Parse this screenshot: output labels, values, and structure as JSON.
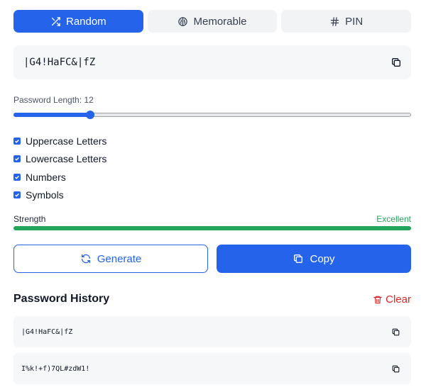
{
  "tabs": [
    {
      "label": "Random",
      "icon": "shuffle-icon",
      "active": true
    },
    {
      "label": "Memorable",
      "icon": "brain-icon",
      "active": false
    },
    {
      "label": "PIN",
      "icon": "hash-icon",
      "active": false
    }
  ],
  "password": {
    "value": "|G4!HaFC&|fZ",
    "copy_icon": "copy-icon"
  },
  "length": {
    "label": "Password Length: 12",
    "value": 12,
    "min": 4,
    "max": 64
  },
  "options": [
    {
      "label": "Uppercase Letters",
      "checked": true
    },
    {
      "label": "Lowercase Letters",
      "checked": true
    },
    {
      "label": "Numbers",
      "checked": true
    },
    {
      "label": "Symbols",
      "checked": true
    }
  ],
  "strength": {
    "label": "Strength",
    "value": "Excellent",
    "level": 1.0,
    "color": "#22a55a"
  },
  "actions": {
    "generate_label": "Generate",
    "copy_label": "Copy"
  },
  "history": {
    "title": "Password History",
    "clear_label": "Clear",
    "items": [
      "|G4!HaFC&|fZ",
      "I%k!+f)7QL#zdW1!"
    ]
  },
  "colors": {
    "accent": "#2563eb",
    "danger": "#dc2626",
    "success": "#22a55a"
  }
}
